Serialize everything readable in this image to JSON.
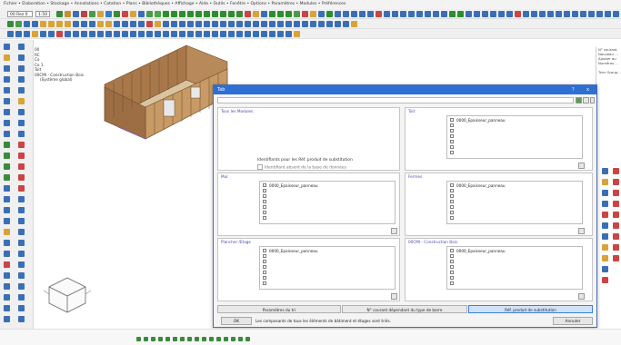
{
  "menubar": {
    "text": "Fichier • Elaboration • Stockage • Annotations • Cotation • Plans • Bibliothèques • Affichage • Aide • Outils • Fenêtre • Options • Paramètres • Modules • Préférences"
  },
  "toolbar": {
    "layer_combo": "00 Rez 0",
    "scale_combo": "1:50"
  },
  "tree": {
    "items": [
      "00",
      "RC",
      "Co",
      "Co 1",
      "Toit",
      "00CMI - Construction Bois",
      "(Système global)"
    ]
  },
  "right_panel": {
    "lines": [
      "N° courant",
      "Nouveau ...",
      "Ajouter au",
      "Numéros ...",
      "",
      "Trier Group..."
    ]
  },
  "dialog": {
    "title": "Tab",
    "title_controls": {
      "help": "?",
      "close": "x"
    },
    "groups": [
      {
        "label": "Tous les Modules",
        "items": []
      },
      {
        "label": "Toit",
        "items": [
          "0000_Epaisseur_panneau"
        ]
      },
      {
        "label": "Mur",
        "items": [
          "0000_Epaisseur_panneau"
        ]
      },
      {
        "label": "Fermes",
        "items": [
          "0000_Epaisseur_panneau"
        ]
      },
      {
        "label": "Plancher /Etage",
        "items": [
          "0000_Epaisseur_panneau"
        ]
      },
      {
        "label": "00CMI - Construction Bois",
        "items": [
          "0000_Epaisseur_panneau"
        ]
      }
    ],
    "info_line1": "Identifiants pour les Réf. produit de substitution",
    "info_line2": "Identifiant absent de la base de données",
    "tabs": [
      "Paramètres du tri",
      "N° courant dépendant du type de barre",
      "Réf. produit de substitution"
    ],
    "active_tab": 2,
    "ok_label": "OK",
    "status_text": "Les composants de tous les éléments de bâtiment et étages sont triés.",
    "cancel_label": "Annuler"
  },
  "colors": {
    "title_bar": "#2d6fd2",
    "group_label": "#4b4bb4",
    "active_tab": "#cfe2fb"
  }
}
